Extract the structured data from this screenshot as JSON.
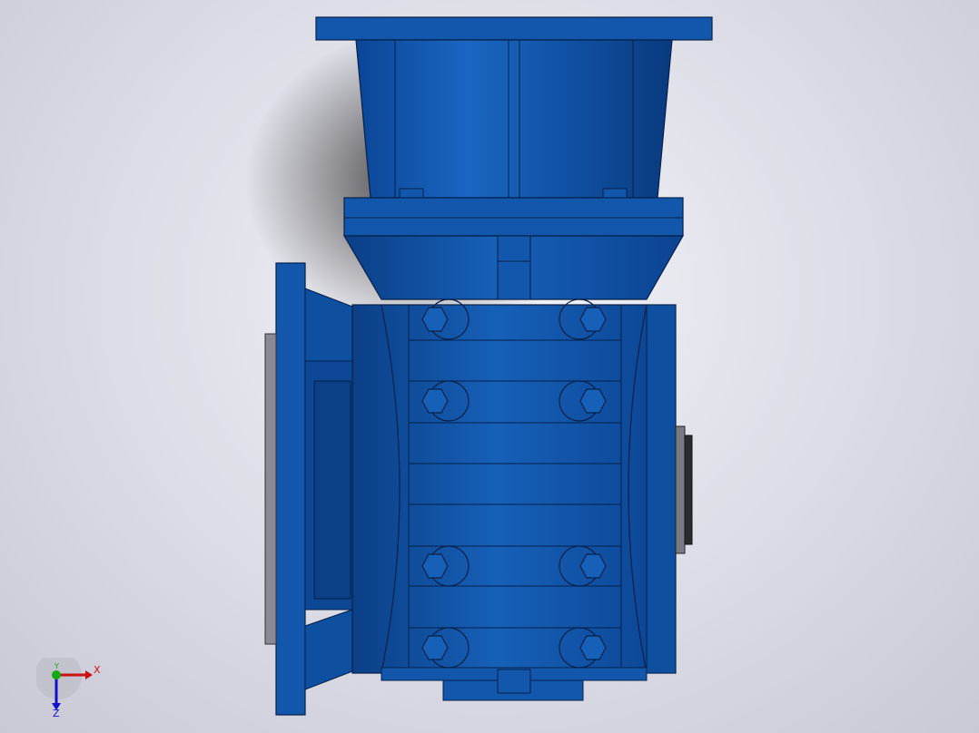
{
  "viewport": {
    "background_center": "#f3f3f8",
    "background_edge": "#c9c9d6"
  },
  "model": {
    "body_color": "#0f4fa0",
    "body_light": "#1b64c0",
    "body_dark": "#0a3a7c",
    "edge_color": "#05204a",
    "bolt_rows": 4,
    "bolts_per_row": 2
  },
  "triad": {
    "x_label": "X",
    "y_label": "Y",
    "z_label": "Z",
    "x_color": "#cc1111",
    "y_color": "#11aa11",
    "z_color": "#1111cc"
  }
}
